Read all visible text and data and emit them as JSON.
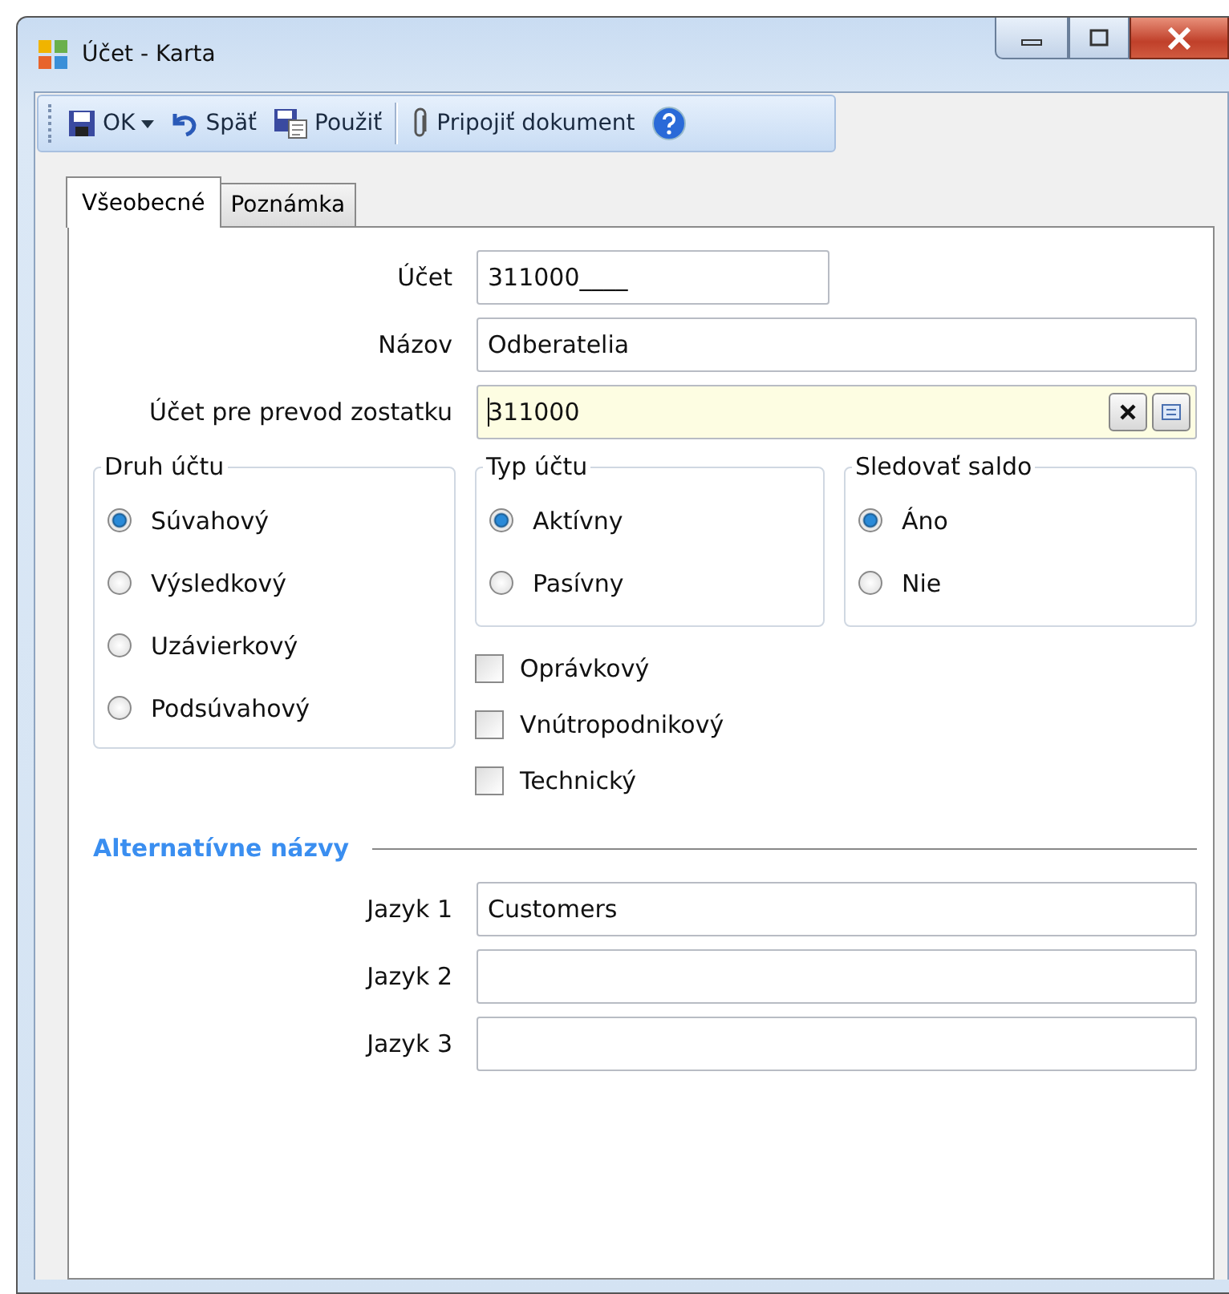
{
  "window": {
    "title": "Účet - Karta"
  },
  "toolbar": [
    {
      "kind": "save",
      "label": "OK",
      "dropdown": true
    },
    {
      "kind": "undo",
      "label": "Späť"
    },
    {
      "kind": "apply",
      "label": "Použiť"
    },
    {
      "kind": "separator"
    },
    {
      "kind": "attach",
      "label": "Pripojiť dokument"
    },
    {
      "kind": "help"
    }
  ],
  "tabs": [
    {
      "label": "Všeobecné",
      "selected": true
    },
    {
      "label": "Poznámka",
      "selected": false
    }
  ],
  "fields": [
    {
      "label": "Účet",
      "value": "311000____",
      "kind": "short"
    },
    {
      "label": "Názov",
      "value": "Odberatelia",
      "kind": "text"
    },
    {
      "label": "Účet pre prevod zostatku",
      "value": "311000",
      "kind": "lookup"
    }
  ],
  "groups": [
    {
      "title": "Druh účtu",
      "options": [
        {
          "label": "Súvahový",
          "selected": true
        },
        {
          "label": "Výsledkový",
          "selected": false
        },
        {
          "label": "Uzávierkový",
          "selected": false
        },
        {
          "label": "Podsúvahový",
          "selected": false
        }
      ]
    },
    {
      "title": "Typ účtu",
      "options": [
        {
          "label": "Aktívny",
          "selected": true
        },
        {
          "label": "Pasívny",
          "selected": false
        }
      ]
    },
    {
      "title": "Sledovať saldo",
      "options": [
        {
          "label": "Áno",
          "selected": true
        },
        {
          "label": "Nie",
          "selected": false
        }
      ]
    }
  ],
  "checkboxes": [
    {
      "label": "Oprávkový",
      "checked": false
    },
    {
      "label": "Vnútropodnikový",
      "checked": false
    },
    {
      "label": "Technický",
      "checked": false
    }
  ],
  "alt_names": {
    "title": "Alternatívne názvy",
    "rows": [
      {
        "label": "Jazyk 1",
        "value": "Customers"
      },
      {
        "label": "Jazyk 2",
        "value": ""
      },
      {
        "label": "Jazyk 3",
        "value": ""
      }
    ]
  }
}
